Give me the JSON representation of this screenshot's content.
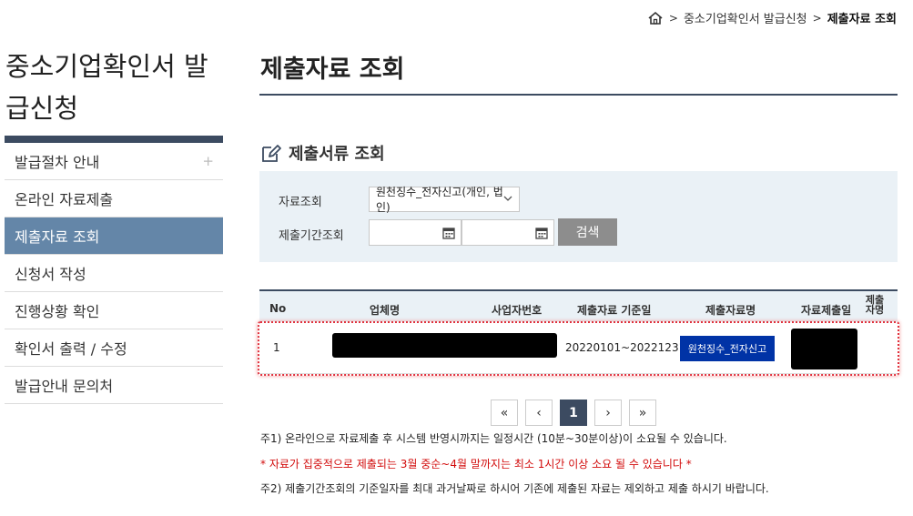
{
  "breadcrumb": {
    "home_icon": "home-icon",
    "items": [
      "중소기업확인서 발급신청",
      "제출자료 조회"
    ]
  },
  "site_title": "중소기업확인서 발급신청",
  "sidebar": {
    "items": [
      {
        "label": "발급절차 안내",
        "has_plus": true
      },
      {
        "label": "온라인 자료제출"
      },
      {
        "label": "제출자료 조회",
        "active": true
      },
      {
        "label": "신청서 작성"
      },
      {
        "label": "진행상황 확인"
      },
      {
        "label": "확인서 출력 / 수정"
      },
      {
        "label": "발급안내 문의처"
      }
    ],
    "plus_glyph": "+"
  },
  "page_title": "제출자료 조회",
  "section": {
    "title": "제출서류 조회",
    "icon": "edit-icon"
  },
  "search": {
    "label_type": "자료조회",
    "select_value": "원천징수_전자신고(개인, 법인)",
    "label_period": "제출기간조회",
    "start_date": "",
    "end_date": "",
    "button": "검색"
  },
  "table": {
    "headers": [
      "No",
      "업체명",
      "사업자번호",
      "제출자료 기준일",
      "제출자료명",
      "자료제출일",
      "제출자명"
    ],
    "rows": [
      {
        "no": "1",
        "company": "",
        "biz_no": "",
        "period": "20220101~20221231",
        "doc_name": "원천징수_전자신고",
        "submit_date": "",
        "submitter": ""
      }
    ]
  },
  "pagination": {
    "first": "«",
    "prev": "‹",
    "current": "1",
    "next": "›",
    "last": "»"
  },
  "notes": {
    "n1": "주1) 온라인으로 자료제출 후 시스템 반영시까지는 일정시간 (10분~30분이상)이 소요될 수 있습니다.",
    "n_red": "* 자료가 집중적으로 제출되는 3월 중순~4월 말까지는 최소 1시간 이상 소요 될 수 있습니다 *",
    "n2": "주2) 제출기간조회의 기준일자를 최대 과거날짜로 하시어 기존에 제출된 자료는 제외하고 제출 하시기 바랍니다."
  },
  "colors": {
    "navy": "#3c4b61",
    "active_menu": "#6486a8",
    "doc_button": "#0033a6",
    "highlight": "#e0313d"
  }
}
